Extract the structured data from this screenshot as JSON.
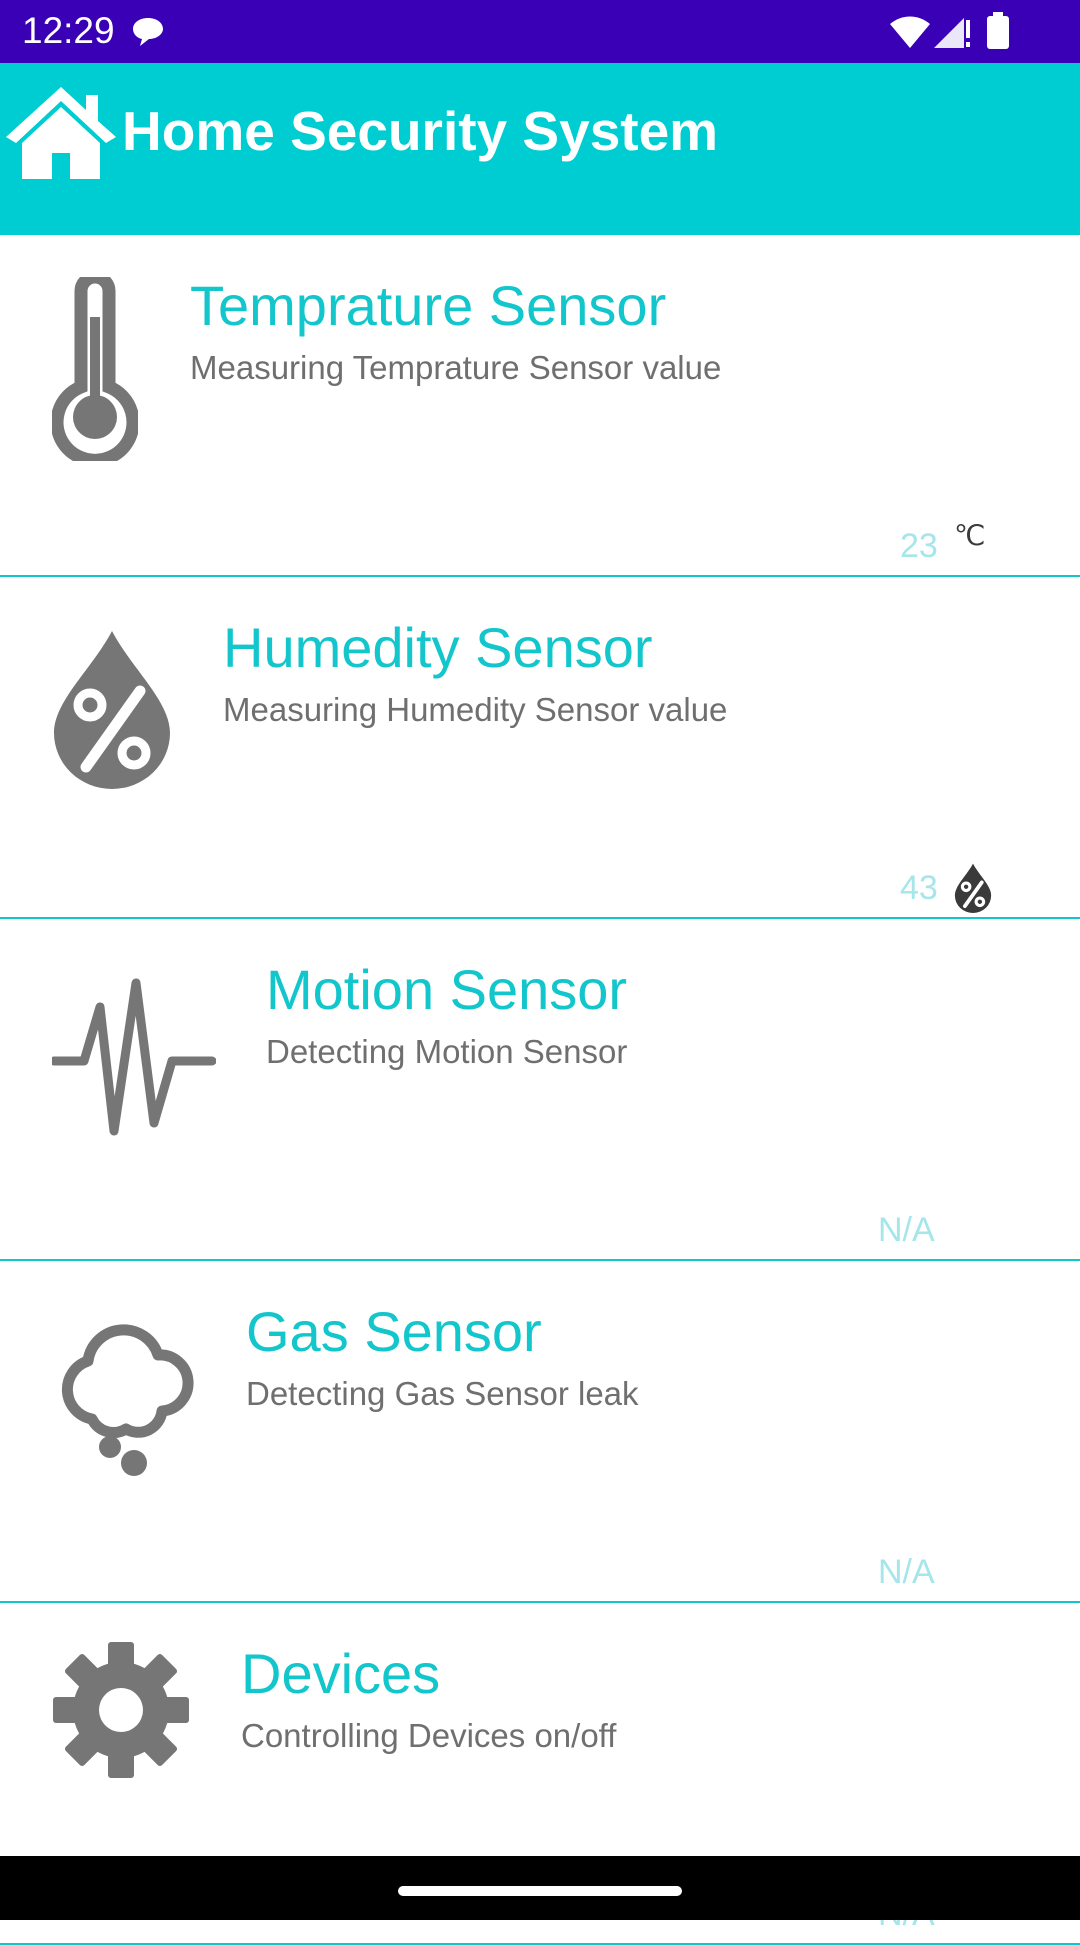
{
  "status_bar": {
    "time": "12:29",
    "icons": [
      "chat-icon",
      "wifi-icon",
      "signal-icon",
      "battery-icon"
    ]
  },
  "app_bar": {
    "title": "Home Security System",
    "icon": "home-icon",
    "color": "#00cdd2"
  },
  "colors": {
    "status_bar": "#3a00b5",
    "accent": "#12c6cc",
    "subtitle": "#6f6f6f",
    "value": "#a5e6ea",
    "icon_gray": "#767676"
  },
  "sensors": [
    {
      "title": "Temprature Sensor",
      "subtitle": "Measuring Temprature Sensor value",
      "value": "23",
      "unit": "℃",
      "icon": "thermometer-icon"
    },
    {
      "title": "Humedity Sensor",
      "subtitle": "Measuring Humedity Sensor value",
      "value": "43",
      "unit_icon": "humidity-drop-icon",
      "icon": "humidity-drop-icon"
    },
    {
      "title": "Motion Sensor",
      "subtitle": "Detecting Motion Sensor",
      "value": "N/A",
      "icon": "pulse-icon"
    },
    {
      "title": "Gas Sensor",
      "subtitle": "Detecting Gas Sensor leak",
      "value": "N/A",
      "icon": "cloud-icon"
    },
    {
      "title": "Devices",
      "subtitle": "Controlling Devices on/off",
      "value": "N/A",
      "icon": "gear-icon"
    }
  ]
}
